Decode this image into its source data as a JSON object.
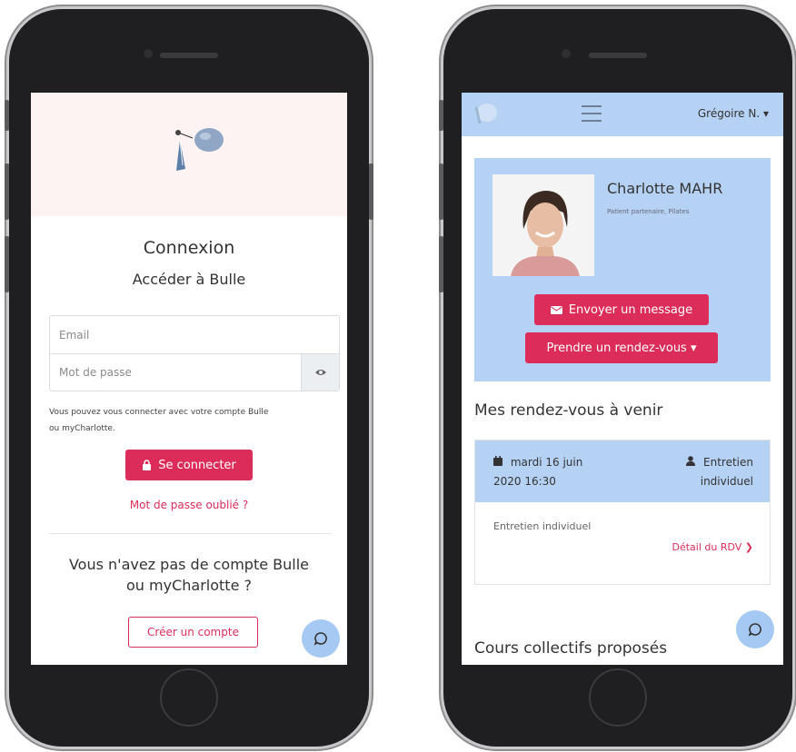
{
  "colors": {
    "accent": "#dc2d5a",
    "light_blue": "#b5d2f5",
    "pink_band": "#fdf3f3"
  },
  "login": {
    "title": "Connexion",
    "subtitle": "Accéder à Bulle",
    "email_placeholder": "Email",
    "password_placeholder": "Mot de passe",
    "password_toggle_icon": "eye-icon",
    "help_line1": "Vous pouvez vous connecter avec votre compte Bulle",
    "help_line2": "ou myCharlotte.",
    "submit_label": "Se connecter",
    "submit_icon": "lock-icon",
    "forgot_label": "Mot de passe oublié ?",
    "no_account_line1": "Vous n'avez pas de compte Bulle",
    "no_account_line2": "ou myCharlotte ?",
    "create_label": "Créer un compte",
    "chat_icon": "chat-bubble-icon"
  },
  "dashboard": {
    "user_menu": "Grégoire N. ▾",
    "profile": {
      "name": "Charlotte MAHR",
      "role": "Patient partenaire, Pilates",
      "message_label": "Envoyer un message",
      "message_icon": "envelope-icon",
      "appointment_label": "Prendre un rendez-vous ▾"
    },
    "upcoming_title": "Mes rendez-vous à venir",
    "appointment": {
      "date_line1": "mardi 16 juin",
      "date_line2": "2020 16:30",
      "type_line1": "Entretien",
      "type_line2": "individuel",
      "description": "Entretien individuel",
      "link_label": "Détail du RDV ❯"
    },
    "courses_title": "Cours collectifs proposés",
    "chat_icon": "chat-bubble-icon"
  }
}
